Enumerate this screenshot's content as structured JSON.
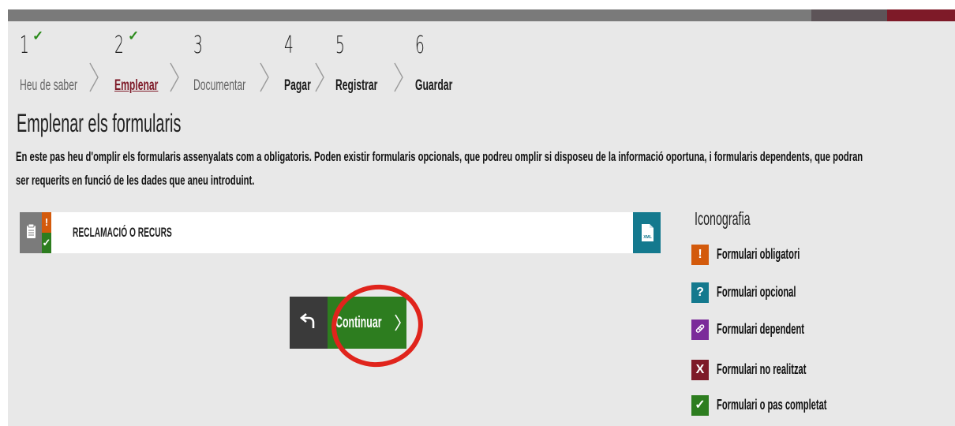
{
  "steps": [
    {
      "number": "1",
      "label": "Heu de saber",
      "completed": true,
      "state": "done"
    },
    {
      "number": "2",
      "label": "Emplenar",
      "completed": true,
      "state": "active"
    },
    {
      "number": "3",
      "label": "Documentar",
      "completed": false,
      "state": "inactive"
    },
    {
      "number": "4",
      "label": "Pagar",
      "completed": false,
      "state": "pending"
    },
    {
      "number": "5",
      "label": "Registrar",
      "completed": false,
      "state": "pending"
    },
    {
      "number": "6",
      "label": "Guardar",
      "completed": false,
      "state": "pending"
    }
  ],
  "check_mark": "✓",
  "page": {
    "title": "Emplenar els formularis",
    "description": "En este pas heu d'omplir els formularis assenyalats com a obligatoris. Poden existir formularis opcionals, que podreu omplir si disposeu de la informació oportuna, i formularis dependents, que podran ser requerits en funció de les dades que aneu introduint."
  },
  "form": {
    "name": "RECLAMACIÓ O RECURS",
    "required_mark": "!",
    "completed_mark": "✓",
    "xml_label": "XML"
  },
  "buttons": {
    "continue_label": "Continuar"
  },
  "legend": {
    "title": "Iconografia",
    "items": [
      {
        "icon": "exclamation-icon",
        "glyph": "!",
        "label": "Formulari obligatori",
        "color": "#d35a0c"
      },
      {
        "icon": "question-icon",
        "glyph": "?",
        "label": "Formulari opcional",
        "color": "#14798e"
      },
      {
        "icon": "link-icon",
        "glyph": "",
        "label": "Formulari dependent",
        "color": "#7b2b9a"
      },
      {
        "icon": "cross-icon",
        "glyph": "X",
        "label": "Formulari no realitzat",
        "color": "#7e1a28"
      },
      {
        "icon": "check-icon",
        "glyph": "✓",
        "label": "Formulari o pas completat",
        "color": "#2d7d1f"
      }
    ]
  },
  "colors": {
    "accent_red": "#7e1a28",
    "success_green": "#2d7d1f",
    "required_orange": "#d35a0c",
    "info_teal": "#14798e",
    "dependent_purple": "#7b2b9a",
    "highlight_ring": "#e0241c"
  }
}
